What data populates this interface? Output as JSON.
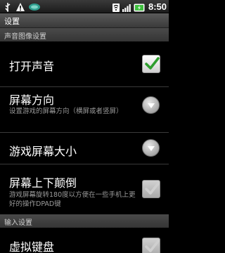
{
  "status_bar": {
    "time": "8:50",
    "left_icons": [
      "usb-icon",
      "warning-icon",
      "sd-card-icon"
    ],
    "right_icons": [
      "wifi-icon",
      "signal-icon",
      "battery-charging-icon"
    ]
  },
  "title": "设置",
  "sections": [
    {
      "header": "声音图像设置",
      "items": [
        {
          "title": "打开声音",
          "summary": "",
          "control": "checkbox",
          "checked": true,
          "enabled": true
        },
        {
          "title": "屏幕方向",
          "summary": "设置游戏的屏幕方向（横屏或者竖屏）",
          "control": "dropdown"
        },
        {
          "title": "游戏屏幕大小",
          "summary": "",
          "control": "dropdown"
        },
        {
          "title": "屏幕上下颠倒",
          "summary": "游戏屏幕旋转180度以方便在一些手机上更好的操作DPAD键",
          "control": "checkbox",
          "checked": false,
          "enabled": false
        }
      ]
    },
    {
      "header": "输入设置",
      "items": [
        {
          "title": "虚拟键盘",
          "summary": "",
          "control": "checkbox",
          "checked": false,
          "enabled": false
        }
      ]
    }
  ],
  "colors": {
    "check_green": "#2e9e2e",
    "summary_text": "#9a9a9a",
    "section_bg": "#3e3e3e"
  }
}
